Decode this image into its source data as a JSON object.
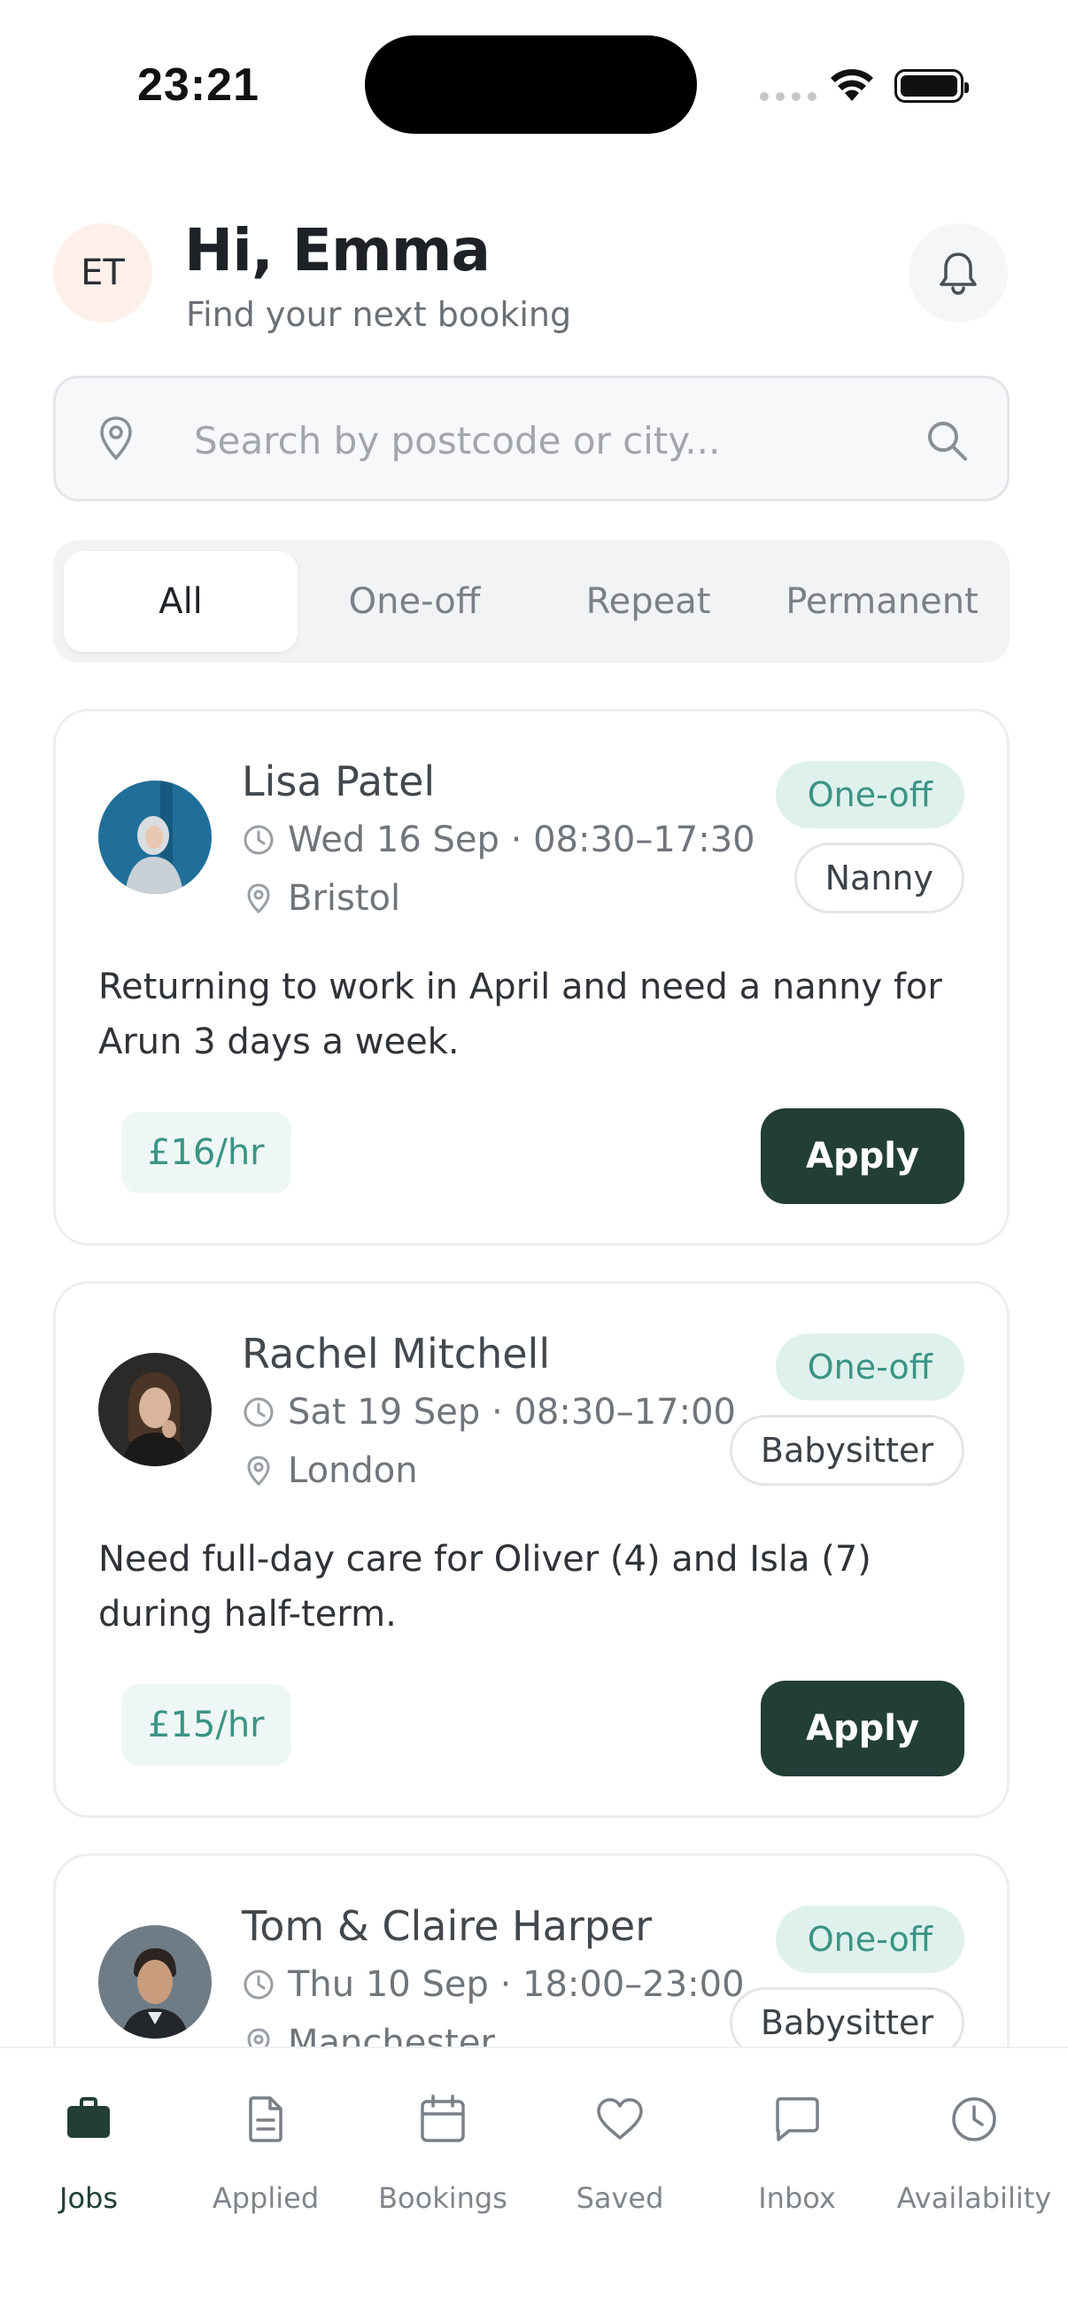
{
  "status_bar": {
    "time": "23:21"
  },
  "header": {
    "avatar_initials": "ET",
    "greeting": "Hi, Emma",
    "subtitle": "Find your next booking"
  },
  "search": {
    "placeholder": "Search by postcode or city..."
  },
  "tabs": [
    {
      "label": "All",
      "active": true
    },
    {
      "label": "One-off",
      "active": false
    },
    {
      "label": "Repeat",
      "active": false
    },
    {
      "label": "Permanent",
      "active": false
    }
  ],
  "jobs": [
    {
      "name": "Lisa Patel",
      "date": "Wed 16 Sep · 08:30–17:30",
      "location": "Bristol",
      "type": "One-off",
      "role": "Nanny",
      "description": "Returning to work in April and need a nanny for Arun 3 days a week.",
      "rate": "£16/hr",
      "apply_label": "Apply"
    },
    {
      "name": "Rachel Mitchell",
      "date": "Sat 19 Sep · 08:30–17:00",
      "location": "London",
      "type": "One-off",
      "role": "Babysitter",
      "description": "Need full-day care for Oliver (4) and Isla (7) during half-term.",
      "rate": "£15/hr",
      "apply_label": "Apply"
    },
    {
      "name": "Tom & Claire Harper",
      "date": "Thu 10 Sep · 18:00–23:00",
      "location": "Manchester",
      "type": "One-off",
      "role": "Babysitter"
    }
  ],
  "bottom_nav": [
    {
      "label": "Jobs",
      "icon": "briefcase-icon",
      "active": true
    },
    {
      "label": "Applied",
      "icon": "document-icon",
      "active": false
    },
    {
      "label": "Bookings",
      "icon": "calendar-icon",
      "active": false
    },
    {
      "label": "Saved",
      "icon": "heart-icon",
      "active": false
    },
    {
      "label": "Inbox",
      "icon": "chat-icon",
      "active": false
    },
    {
      "label": "Availability",
      "icon": "clock-icon",
      "active": false
    }
  ],
  "colors": {
    "primary": "#223e37",
    "accent": "#3a9485",
    "accent_bg": "#dff1ed"
  }
}
